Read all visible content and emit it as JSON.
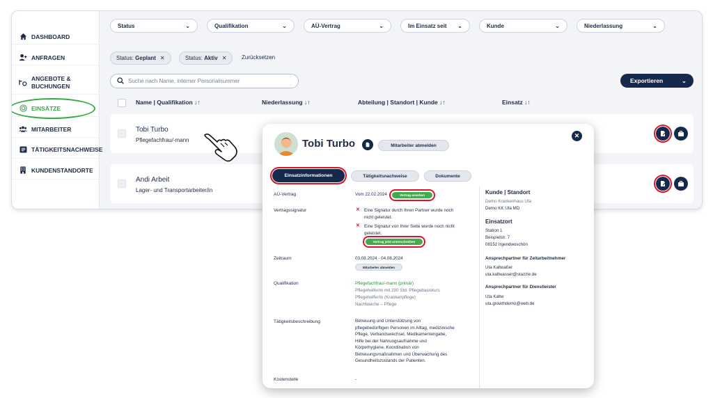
{
  "sidebar": {
    "items": [
      {
        "label": "DASHBOARD",
        "icon": "home-icon"
      },
      {
        "label": "ANFRAGEN",
        "icon": "user-plus-icon"
      },
      {
        "label": "ANGEBOTE &",
        "label2": "BUCHUNGEN",
        "icon": "offers-icon"
      },
      {
        "label": "EINSÄTZE",
        "icon": "target-icon",
        "active": true
      },
      {
        "label": "MITARBEITER",
        "icon": "users-icon"
      },
      {
        "label": "TÄTIGKEITSNACHWEISE",
        "icon": "list-icon"
      },
      {
        "label": "KUNDENSTANDORTE",
        "icon": "building-icon"
      }
    ]
  },
  "filters": [
    "Status",
    "Qualifikation",
    "AÜ-Vertrag",
    "Im Einsatz seit",
    "Kunde",
    "Niederlassung"
  ],
  "chips": [
    {
      "prefix": "Status:",
      "value": "Geplant"
    },
    {
      "prefix": "Status:",
      "value": "Aktiv"
    }
  ],
  "reset_label": "Zurücksetzen",
  "search": {
    "placeholder": "Suche nach Name, interner Personalnummer"
  },
  "export_label": "Exportieren",
  "table": {
    "headers": [
      "Name | Qualifikation ↓↑",
      "Niederlassung ↓↑",
      "Abteilung | Standort | Kunde ↓↑",
      "Einsatz ↓↑"
    ],
    "rows": [
      {
        "name": "Tobi Turbo",
        "qualification": "Pflegefachfrau/-mann"
      },
      {
        "name": "Andi Arbeit",
        "qualification": "Lager- und Transportarbeiter/in"
      }
    ]
  },
  "modal": {
    "name": "Tobi Turbo",
    "unregister_label": "Mitarbeiter abmelden",
    "tabs": [
      "Einsatzinformationen",
      "Tätigkeitsnachweise",
      "Dokumente"
    ],
    "fields": {
      "au_label": "AÜ-Vertrag",
      "au_value": "Vom 22.02.2024",
      "au_button": "Vertrag ansehen",
      "sig_label": "Vertragssignatur",
      "sig_1": "Eine Signatur durch Ihren Partner wurde noch",
      "sig_1b": "nicht geleistet.",
      "sig_2": "Eine Signatur von Ihrer Seite wurde noch nicht",
      "sig_2b": "geleistet.",
      "sig_button": "Vertrag jetzt unterschreiben",
      "period_label": "Zeitraum",
      "period_value": "03.08.2024 - 04.08.2024",
      "period_button": "Mitarbeiter abmelden",
      "qual_label": "Qualifikation",
      "qual_main": "Pflegefachfrau/-mann (primär)",
      "qual_2": "Pflegehelfer/in mit 200 Std. Pflegebasiskurs",
      "qual_3": "Pflegehelfer/in (Krankenpflege)",
      "qual_4": "Nachtwache – Pflege",
      "desc_label": "Tätigkeitsbeschreibung",
      "desc_lines": [
        "Betreuung und Unterstützung von",
        "pflegebedürftigen Personen im Alltag, medizinische",
        "Pflege, Verbandswechsel, Medikamentengabe,",
        "Hilfe bei der Nahrungsaufnahme und",
        "Körperhygiene, Koordination von",
        "Betreuungsmaßnahmen und Überwachung des",
        "Gesundheitszustands der Patienten."
      ],
      "cost_label": "Kostenstelle",
      "cost_value": "-"
    },
    "right": {
      "customer_heading": "Kunde | Standort",
      "customer_1": "Demo Krankenhaus Uta",
      "customer_2": "Demo KK Uta MD",
      "location_heading": "Einsatzort",
      "location_1": "Station 1",
      "location_2": "Beispielstr. 7",
      "location_3": "08152 Irgendwoschön",
      "contact1_heading": "Ansprechpartner für Zeitarbeitnehmer",
      "contact1_name": "Uta Kaltwaßer",
      "contact1_mail": "uta.kaltwasser@stazzle.de",
      "contact2_heading": "Ansprechpartner für Dienstleister",
      "contact2_name": "Uta Kaltw",
      "contact2_mail": "uta.growthdemo@web.de"
    }
  },
  "colors": {
    "navy": "#15294d",
    "green": "#3fa648",
    "highlight_red": "#d8162a"
  }
}
